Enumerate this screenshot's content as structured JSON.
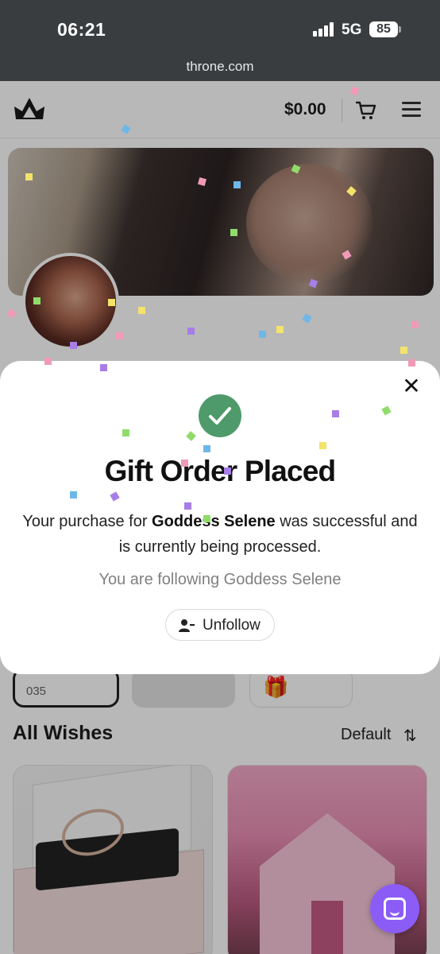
{
  "status_bar": {
    "time": "06:21",
    "network": "5G",
    "battery": "85",
    "url": "throne.com"
  },
  "header": {
    "logo_icon": "crown-logo-icon",
    "balance": "$0.00",
    "cart_icon": "cart-icon",
    "menu_icon": "hamburger-menu-icon"
  },
  "profile": {
    "banner_icon": "profile-banner-photo",
    "avatar_icon": "profile-avatar-photo"
  },
  "filter_chips": {
    "first_label": "035",
    "third_icon": "gift-icon"
  },
  "wishes": {
    "title": "All Wishes",
    "sort_label": "Default",
    "sort_icon": "sort-arrows-icon",
    "items": [
      {
        "image_icon": "jewelry-box-photo"
      },
      {
        "image_icon": "pink-house-photo"
      }
    ]
  },
  "modal": {
    "title": "Gift Order Placed",
    "message_before": "Your purchase for ",
    "creator_name": "Goddess Selene",
    "message_after": " was successful and is currently being processed.",
    "following_text": "You are following Goddess Selene",
    "unfollow_label": "Unfollow",
    "close_icon": "close-icon",
    "success_icon": "check-circle-icon"
  },
  "chat": {
    "icon": "chat-bubble-icon"
  },
  "colors": {
    "success_green": "#4e9a6b",
    "chat_purple": "#8b5cf6",
    "status_bar_bg": "#3a3d40"
  }
}
